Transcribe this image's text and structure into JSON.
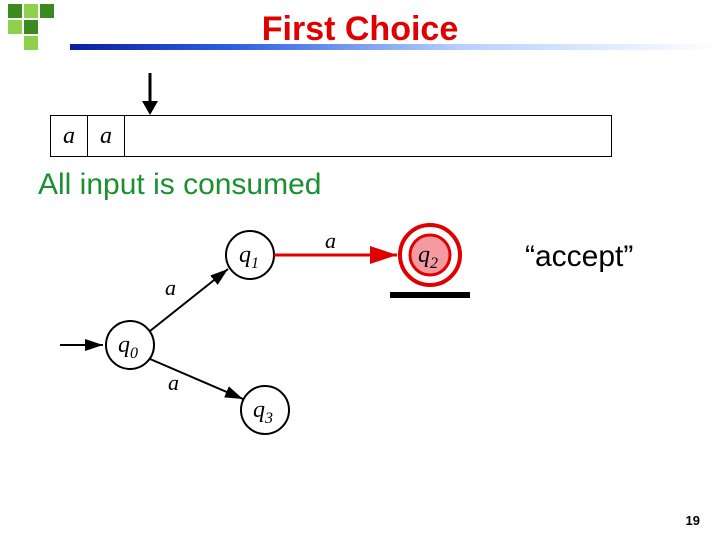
{
  "title": "First Choice",
  "subtitle": "All input is consumed",
  "accept_label": "“accept”",
  "tape": {
    "cells": [
      "a",
      "a"
    ]
  },
  "states": {
    "q0": "q",
    "q0_sub": "0",
    "q1": "q",
    "q1_sub": "1",
    "q2": "q",
    "q2_sub": "2",
    "q3": "q",
    "q3_sub": "3"
  },
  "edges": {
    "q0_q1": "a",
    "q0_q3": "a",
    "q1_q2": "a"
  },
  "page_number": "19"
}
